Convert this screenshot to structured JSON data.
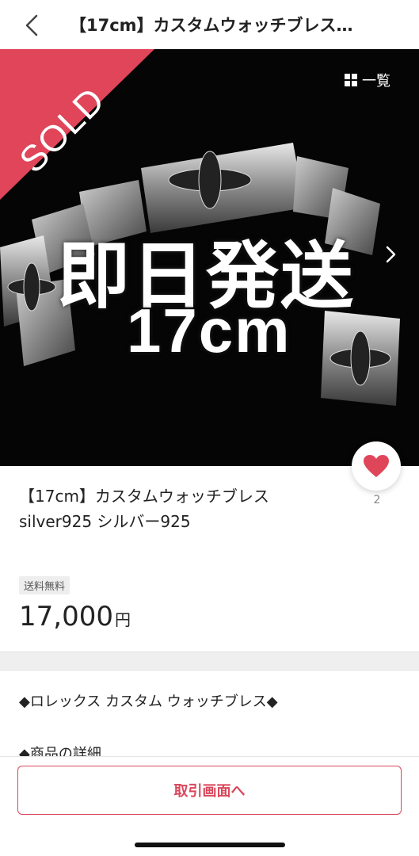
{
  "header": {
    "title": "【17cm】カスタムウォッチブレス…",
    "back_icon": "chevron-left-icon"
  },
  "hero": {
    "sold_label": "SOLD",
    "list_label": "一覧",
    "overlay_main": "即日発送",
    "overlay_sub": "17cm",
    "next_icon": "chevron-right-icon"
  },
  "like": {
    "count": "2",
    "icon": "heart-icon",
    "color": "#e0465a"
  },
  "item": {
    "title_line1": "【17cm】カスタムウォッチブレス",
    "title_line2": "silver925 シルバー925",
    "shipping_badge": "送料無料",
    "price": "17,000",
    "currency": "円"
  },
  "description": {
    "line1": "◆ロレックス カスタム ウォッチブレス◆",
    "line2": "◆商品の詳細"
  },
  "footer": {
    "cta_label": "取引画面へ"
  },
  "colors": {
    "accent": "#d9475b",
    "sold_banner": "#e0455a"
  }
}
